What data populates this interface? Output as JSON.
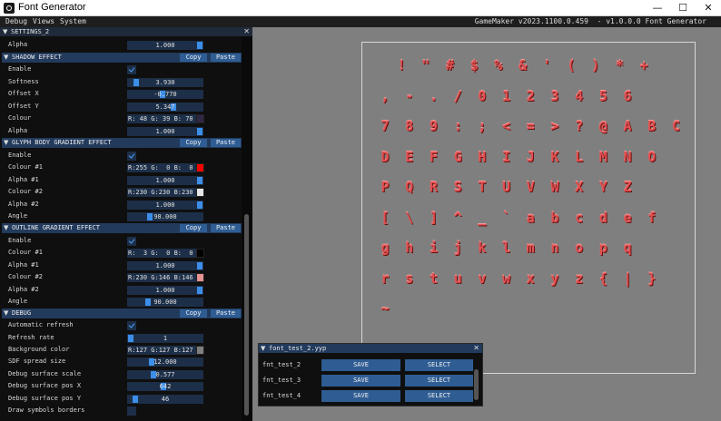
{
  "window": {
    "title": "Font Generator",
    "minimize": "—",
    "maximize": "☐",
    "close": "✕"
  },
  "menu": {
    "items": [
      "Debug",
      "Views",
      "System"
    ],
    "version": "GameMaker v2023.1100.0.459  - v1.0.0.0 Font Generator"
  },
  "settings": {
    "title": "SETTINGS_2",
    "close": "✕",
    "alpha_top": {
      "label": "Alpha",
      "value": "1.000",
      "fraction": 1.0
    },
    "shadow": {
      "title": "SHADOW EFFECT",
      "copy": "Copy",
      "paste": "Paste",
      "enable": {
        "label": "Enable",
        "checked": true
      },
      "softness": {
        "label": "Softness",
        "value": "3.930",
        "fraction": 0.08
      },
      "offset_x": {
        "label": "Offset X",
        "value": "-0.770",
        "fraction": 0.46
      },
      "offset_y": {
        "label": "Offset Y",
        "value": "5.347",
        "fraction": 0.62
      },
      "colour": {
        "label": "Colour",
        "value": "R: 48 G: 39 B: 70",
        "hex": "#302746"
      },
      "alpha": {
        "label": "Alpha",
        "value": "1.000",
        "fraction": 1.0
      }
    },
    "glyph_gradient": {
      "title": "GLYPH BODY GRADIENT EFFECT",
      "copy": "Copy",
      "paste": "Paste",
      "enable": {
        "label": "Enable",
        "checked": true
      },
      "colour1": {
        "label": "Colour #1",
        "value": "R:255 G:  0 B:  0",
        "hex": "#ff0000"
      },
      "alpha1": {
        "label": "Alpha #1",
        "value": "1.000",
        "fraction": 1.0
      },
      "colour2": {
        "label": "Colour #2",
        "value": "R:230 G:230 B:230",
        "hex": "#e6e6e6"
      },
      "alpha2": {
        "label": "Alpha #2",
        "value": "1.000",
        "fraction": 1.0
      },
      "angle": {
        "label": "Angle",
        "value": "98.000",
        "fraction": 0.27
      }
    },
    "outline_gradient": {
      "title": "OUTLINE GRADIENT EFFECT",
      "copy": "Copy",
      "paste": "Paste",
      "enable": {
        "label": "Enable",
        "checked": true
      },
      "colour1": {
        "label": "Colour #1",
        "value": "R:  3 G:  0 B:  0",
        "hex": "#030000"
      },
      "alpha1": {
        "label": "Alpha #1",
        "value": "1.000",
        "fraction": 1.0
      },
      "colour2": {
        "label": "Colour #2",
        "value": "R:230 G:146 B:146",
        "hex": "#e69292"
      },
      "alpha2": {
        "label": "Alpha #2",
        "value": "1.000",
        "fraction": 1.0
      },
      "angle": {
        "label": "Angle",
        "value": "90.000",
        "fraction": 0.25
      }
    },
    "debug": {
      "title": "DEBUG",
      "copy": "Copy",
      "paste": "Paste",
      "auto_refresh": {
        "label": "Automatic refresh",
        "checked": true
      },
      "refresh_rate": {
        "label": "Refresh rate",
        "value": "1",
        "fraction": 0.0
      },
      "background": {
        "label": "Background color",
        "value": "R:127 G:127 B:127",
        "hex": "#7f7f7f"
      },
      "sdf_spread": {
        "label": "SDF spread size",
        "value": "12.000",
        "fraction": 0.3
      },
      "surface_scale": {
        "label": "Debug surface scale",
        "value": "0.577",
        "fraction": 0.33
      },
      "pos_x": {
        "label": "Debug surface pos X",
        "value": "642",
        "fraction": 0.48
      },
      "pos_y": {
        "label": "Debug surface pos Y",
        "value": "46",
        "fraction": 0.06
      },
      "draw_borders": {
        "label": "Draw symbols borders",
        "checked": false
      }
    }
  },
  "preview": {
    "rows": [
      "!\"#$%&'()*+",
      ",-./0123456",
      "789:;<=>?@ABC",
      "DEFGHIJKLMNO",
      "PQRSTUVWXYZ",
      "[\\]^_`abcdef",
      "ghijklmnopq",
      "rstuvwxyz{|}",
      "~"
    ]
  },
  "yyp": {
    "title": "font_test_2.yyp",
    "close": "✕",
    "rows": [
      {
        "name": "fnt_test_2",
        "save": "SAVE",
        "select": "SELECT"
      },
      {
        "name": "fnt_test_3",
        "save": "SAVE",
        "select": "SELECT"
      },
      {
        "name": "fnt_test_4",
        "save": "SAVE",
        "select": "SELECT"
      }
    ]
  }
}
